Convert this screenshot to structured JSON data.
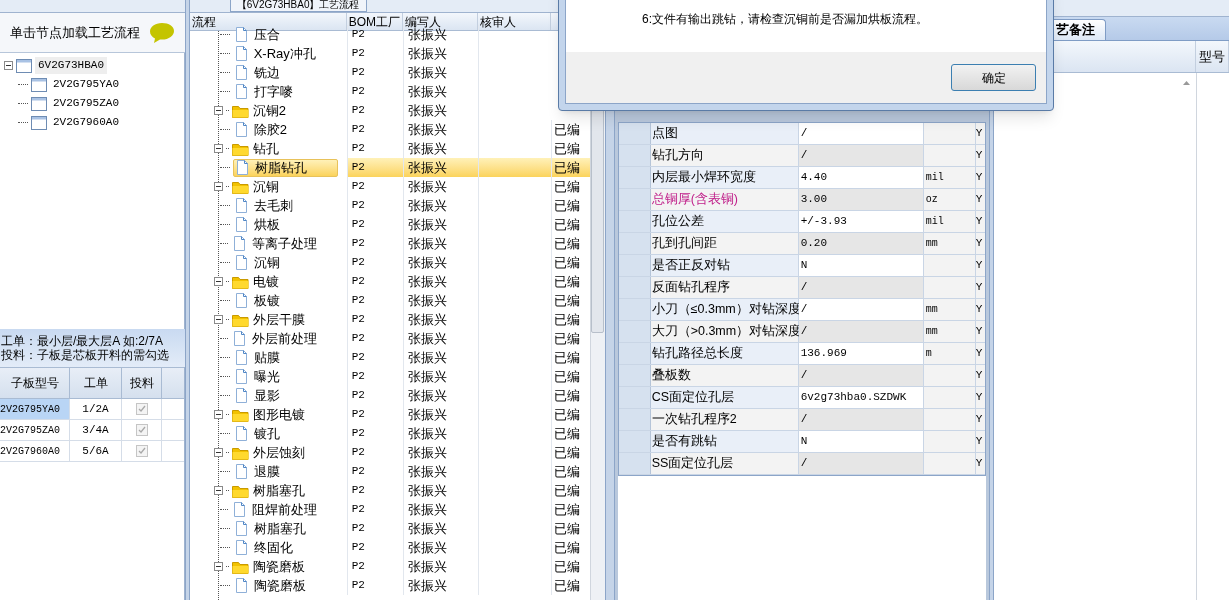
{
  "left_panel": {
    "title": "单击节点加载工艺流程",
    "tree": [
      {
        "label": "6V2G73HBA0",
        "expanded": true,
        "children": [
          {
            "label": "2V2G795YA0"
          },
          {
            "label": "2V2G795ZA0"
          },
          {
            "label": "2V2G7960A0"
          }
        ]
      }
    ],
    "hints": [
      "工单：最小层/最大层A 如:2/7A",
      "投料：子板是芯板开料的需勾选"
    ],
    "grid": {
      "columns": [
        "子板型号",
        "工单",
        "投料"
      ],
      "rows": [
        {
          "model": "2V2G795YA0",
          "order": "1/2A",
          "feed": true,
          "disabled": true,
          "selected": true
        },
        {
          "model": "2V2G795ZA0",
          "order": "3/4A",
          "feed": true,
          "disabled": true,
          "selected": false
        },
        {
          "model": "2V2G7960A0",
          "order": "5/6A",
          "feed": true,
          "disabled": true,
          "selected": false
        }
      ]
    }
  },
  "process_panel": {
    "tab": "【6V2G73HBA0】工艺流程",
    "columns": [
      "流程",
      "BOM工厂",
      "编写人",
      "核审人"
    ],
    "tree": [
      {
        "children": [
          {
            "label": "压合",
            "bom": "P2",
            "author": "张振兴",
            "selected": false
          },
          {
            "label": "X-Ray冲孔",
            "bom": "P2",
            "author": "张振兴",
            "selected": false
          },
          {
            "label": "铣边",
            "bom": "P2",
            "author": "张振兴",
            "selected": false
          },
          {
            "label": "打字嘜",
            "bom": "P2",
            "author": "张振兴",
            "selected": false
          }
        ]
      },
      {
        "label": "沉铜2",
        "bom": "P2",
        "author": "张振兴",
        "selected": false,
        "expanded": true,
        "children": [
          {
            "label": "除胶2",
            "bom": "P2",
            "author": "张振兴",
            "status": "已编",
            "selected": false
          }
        ]
      },
      {
        "label": "钻孔",
        "bom": "P2",
        "author": "张振兴",
        "status": "已编",
        "selected": false,
        "expanded": true,
        "children": [
          {
            "label": "树脂钻孔",
            "bom": "P2",
            "author": "张振兴",
            "status": "已编",
            "selected": true
          }
        ]
      },
      {
        "label": "沉铜",
        "bom": "P2",
        "author": "张振兴",
        "status": "已编",
        "selected": false,
        "expanded": true,
        "children": [
          {
            "label": "去毛刺",
            "bom": "P2",
            "author": "张振兴",
            "status": "已编",
            "selected": false
          },
          {
            "label": "烘板",
            "bom": "P2",
            "author": "张振兴",
            "status": "已编",
            "selected": false
          },
          {
            "label": "等离子处理",
            "bom": "P2",
            "author": "张振兴",
            "status": "已编",
            "selected": false
          },
          {
            "label": "沉铜",
            "bom": "P2",
            "author": "张振兴",
            "status": "已编",
            "selected": false
          }
        ]
      },
      {
        "label": "电镀",
        "bom": "P2",
        "author": "张振兴",
        "status": "已编",
        "selected": false,
        "expanded": true,
        "children": [
          {
            "label": "板镀",
            "bom": "P2",
            "author": "张振兴",
            "status": "已编",
            "selected": false
          }
        ]
      },
      {
        "label": "外层干膜",
        "bom": "P2",
        "author": "张振兴",
        "status": "已编",
        "selected": false,
        "expanded": true,
        "children": [
          {
            "label": "外层前处理",
            "bom": "P2",
            "author": "张振兴",
            "status": "已编",
            "selected": false
          },
          {
            "label": "贴膜",
            "bom": "P2",
            "author": "张振兴",
            "status": "已编",
            "selected": false
          },
          {
            "label": "曝光",
            "bom": "P2",
            "author": "张振兴",
            "status": "已编",
            "selected": false
          },
          {
            "label": "显影",
            "bom": "P2",
            "author": "张振兴",
            "status": "已编",
            "selected": false
          }
        ]
      },
      {
        "label": "图形电镀",
        "bom": "P2",
        "author": "张振兴",
        "status": "已编",
        "selected": false,
        "expanded": true,
        "children": [
          {
            "label": "镀孔",
            "bom": "P2",
            "author": "张振兴",
            "status": "已编",
            "selected": false
          }
        ]
      },
      {
        "label": "外层蚀刻",
        "bom": "P2",
        "author": "张振兴",
        "status": "已编",
        "selected": false,
        "expanded": true,
        "children": [
          {
            "label": "退膜",
            "bom": "P2",
            "author": "张振兴",
            "status": "已编",
            "selected": false
          }
        ]
      },
      {
        "label": "树脂塞孔",
        "bom": "P2",
        "author": "张振兴",
        "status": "已编",
        "selected": false,
        "expanded": true,
        "children": [
          {
            "label": "阻焊前处理",
            "bom": "P2",
            "author": "张振兴",
            "status": "已编",
            "selected": false
          },
          {
            "label": "树脂塞孔",
            "bom": "P2",
            "author": "张振兴",
            "status": "已编",
            "selected": false
          },
          {
            "label": "终固化",
            "bom": "P2",
            "author": "张振兴",
            "status": "已编",
            "selected": false
          }
        ]
      },
      {
        "label": "陶瓷磨板",
        "bom": "P2",
        "author": "张振兴",
        "status": "已编",
        "selected": false,
        "expanded": true,
        "children": [
          {
            "label": "陶瓷磨板",
            "bom": "P2",
            "author": "张振兴",
            "status": "已编",
            "selected": false
          }
        ]
      }
    ]
  },
  "param_table": {
    "rows": [
      {
        "name": "点图",
        "value": "/",
        "editable": true,
        "highlighted": false,
        "flag": "Y"
      },
      {
        "name": "钻孔方向",
        "value": "/",
        "editable": false,
        "highlighted": false,
        "flag": "Y"
      },
      {
        "name": "内层最小焊环宽度",
        "value": "4.40",
        "unit": "mil",
        "editable": true,
        "highlighted": false,
        "flag": "Y"
      },
      {
        "name": "总铜厚(含表铜)",
        "value": "3.00",
        "unit": "oz",
        "editable": false,
        "highlighted": true,
        "flag": "Y"
      },
      {
        "name": "孔位公差",
        "value": "+/-3.93",
        "unit": "mil",
        "editable": true,
        "highlighted": false,
        "flag": "Y"
      },
      {
        "name": "孔到孔间距",
        "value": "0.20",
        "unit": "mm",
        "editable": false,
        "highlighted": false,
        "flag": "Y"
      },
      {
        "name": "是否正反对钻",
        "value": "N",
        "editable": true,
        "highlighted": false,
        "flag": "Y"
      },
      {
        "name": "反面钻孔程序",
        "value": "/",
        "editable": false,
        "highlighted": false,
        "flag": "Y"
      },
      {
        "name": "小刀（≤0.3mm）对钻深度",
        "value": "/",
        "unit": "mm",
        "editable": true,
        "highlighted": false,
        "flag": "Y"
      },
      {
        "name": "大刀（>0.3mm）对钻深度",
        "value": "/",
        "unit": "mm",
        "editable": false,
        "highlighted": false,
        "flag": "Y"
      },
      {
        "name": "钻孔路径总长度",
        "value": "136.969",
        "unit": "m",
        "editable": true,
        "highlighted": false,
        "flag": "Y"
      },
      {
        "name": "叠板数",
        "value": "/",
        "editable": false,
        "highlighted": false,
        "flag": "Y"
      },
      {
        "name": "CS面定位孔层",
        "value": "6v2g73hba0.SZDWK",
        "editable": true,
        "highlighted": false,
        "flag": "Y"
      },
      {
        "name": "一次钻孔程序2",
        "value": "/",
        "editable": false,
        "highlighted": false,
        "flag": "Y"
      },
      {
        "name": "是否有跳钻",
        "value": "N",
        "editable": true,
        "highlighted": false,
        "flag": "Y"
      },
      {
        "name": "SS面定位孔层",
        "value": "/",
        "editable": false,
        "highlighted": false,
        "flag": "Y"
      }
    ]
  },
  "notes_panel": {
    "tabs": [
      {
        "label": "艺备注",
        "selected": true
      }
    ],
    "columns": [
      "",
      "型号"
    ]
  },
  "dialog": {
    "message": "6:文件有输出跳钻，请检查沉铜前是否漏加烘板流程。",
    "button": "确定"
  }
}
